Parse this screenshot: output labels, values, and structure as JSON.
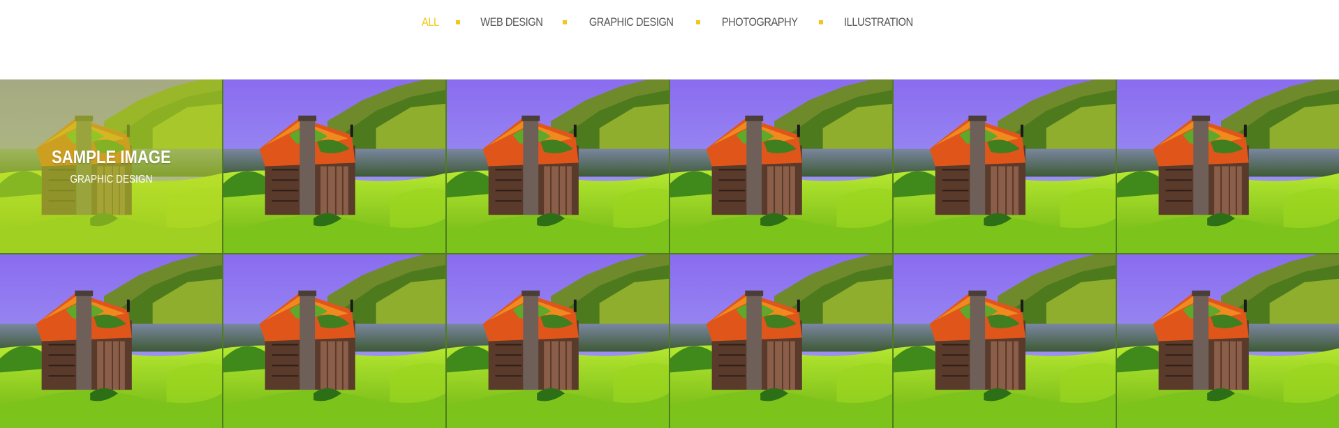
{
  "filters": [
    {
      "label": "ALL",
      "active": true
    },
    {
      "label": "WEB DESIGN",
      "active": false
    },
    {
      "label": "GRAPHIC DESIGN",
      "active": false
    },
    {
      "label": "PHOTOGRAPHY",
      "active": false
    },
    {
      "label": "ILLUSTRATION",
      "active": false
    }
  ],
  "colors": {
    "accent": "#f5c518",
    "nav_text": "#555555",
    "overlay": "#bedc28"
  },
  "portfolio": {
    "hover_item": {
      "title": "SAMPLE IMAGE",
      "category": "GRAPHIC DESIGN"
    },
    "item_count": 12
  }
}
